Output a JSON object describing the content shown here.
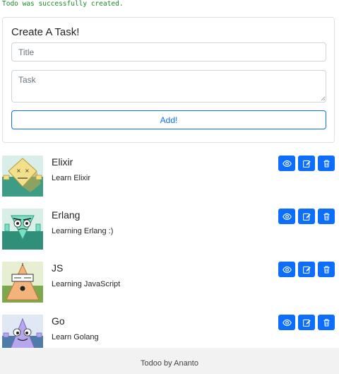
{
  "flash": {
    "message": "Todo was successfully created."
  },
  "form": {
    "heading": "Create A Task!",
    "title_placeholder": "Title",
    "task_placeholder": "Task",
    "submit_label": "Add!"
  },
  "todos": [
    {
      "name": "Elixir",
      "description": "Learn Elixir",
      "avatar": "elixir-robot-avatar"
    },
    {
      "name": "Erlang",
      "description": "Learning Erlang :)",
      "avatar": "erlang-robot-avatar"
    },
    {
      "name": "JS",
      "description": "Learning JavaScript",
      "avatar": "js-robot-avatar"
    },
    {
      "name": "Go",
      "description": "Learn Golang",
      "avatar": "go-robot-avatar"
    }
  ],
  "actions": {
    "view_icon": "eye-icon",
    "edit_icon": "edit-icon",
    "delete_icon": "trash-icon"
  },
  "colors": {
    "primary": "#0d6efd",
    "flash": "#1a8a2a",
    "footer_bg": "#f2f2f2"
  },
  "footer": {
    "text": "Todoo by Ananto"
  }
}
